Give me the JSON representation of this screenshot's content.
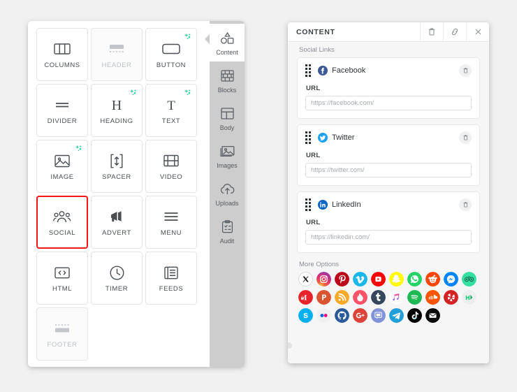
{
  "left_panel": {
    "tiles": [
      {
        "label": "COLUMNS",
        "icon": "columns-icon",
        "disabled": false,
        "sparkle": false,
        "selected": false
      },
      {
        "label": "HEADER",
        "icon": "header-icon",
        "disabled": true,
        "sparkle": false,
        "selected": false
      },
      {
        "label": "BUTTON",
        "icon": "button-icon",
        "disabled": false,
        "sparkle": true,
        "selected": false
      },
      {
        "label": "DIVIDER",
        "icon": "divider-icon",
        "disabled": false,
        "sparkle": false,
        "selected": false
      },
      {
        "label": "HEADING",
        "icon": "heading-icon",
        "disabled": false,
        "sparkle": true,
        "selected": false
      },
      {
        "label": "TEXT",
        "icon": "text-icon",
        "disabled": false,
        "sparkle": true,
        "selected": false
      },
      {
        "label": "IMAGE",
        "icon": "image-icon",
        "disabled": false,
        "sparkle": true,
        "selected": false
      },
      {
        "label": "SPACER",
        "icon": "spacer-icon",
        "disabled": false,
        "sparkle": false,
        "selected": false
      },
      {
        "label": "VIDEO",
        "icon": "video-icon",
        "disabled": false,
        "sparkle": false,
        "selected": false
      },
      {
        "label": "SOCIAL",
        "icon": "social-icon",
        "disabled": false,
        "sparkle": false,
        "selected": true
      },
      {
        "label": "ADVERT",
        "icon": "advert-icon",
        "disabled": false,
        "sparkle": false,
        "selected": false
      },
      {
        "label": "MENU",
        "icon": "menu-icon",
        "disabled": false,
        "sparkle": false,
        "selected": false
      },
      {
        "label": "HTML",
        "icon": "html-icon",
        "disabled": false,
        "sparkle": false,
        "selected": false
      },
      {
        "label": "TIMER",
        "icon": "timer-icon",
        "disabled": false,
        "sparkle": false,
        "selected": false
      },
      {
        "label": "FEEDS",
        "icon": "feeds-icon",
        "disabled": false,
        "sparkle": false,
        "selected": false
      },
      {
        "label": "FOOTER",
        "icon": "footer-icon",
        "disabled": true,
        "sparkle": false,
        "selected": false
      }
    ],
    "selection_color": "#f41616",
    "sparkle_color": "#2fcf95",
    "tabs": [
      {
        "label": "Content",
        "icon": "shapes-icon",
        "active": true
      },
      {
        "label": "Blocks",
        "icon": "bricks-icon",
        "active": false
      },
      {
        "label": "Body",
        "icon": "layout-icon",
        "active": false
      },
      {
        "label": "Images",
        "icon": "photo-icon",
        "active": false
      },
      {
        "label": "Uploads",
        "icon": "cloud-upload-icon",
        "active": false
      },
      {
        "label": "Audit",
        "icon": "clipboard-check-icon",
        "active": false
      }
    ]
  },
  "right_panel": {
    "title": "CONTENT",
    "header_buttons": [
      {
        "name": "delete-button",
        "icon": "trash-icon"
      },
      {
        "name": "duplicate-button",
        "icon": "link-copy-icon"
      },
      {
        "name": "close-button",
        "icon": "close-icon"
      }
    ],
    "social_links_label": "Social Links",
    "more_options_label": "More Options",
    "url_field_label": "URL",
    "links": [
      {
        "name": "Facebook",
        "brand_color": "#3b5998",
        "placeholder": "https://facebook.com/",
        "value": ""
      },
      {
        "name": "Twitter",
        "brand_color": "#1da1f2",
        "placeholder": "https://twitter.com/",
        "value": ""
      },
      {
        "name": "LinkedIn",
        "brand_color": "#0a66c2",
        "placeholder": "https://linkedin.com/",
        "value": ""
      }
    ],
    "more_icons": [
      {
        "name": "x-twitter",
        "color": "#ffffff"
      },
      {
        "name": "instagram",
        "color": "#e1306c"
      },
      {
        "name": "pinterest",
        "color": "#bd081c"
      },
      {
        "name": "vimeo",
        "color": "#1ab7ea"
      },
      {
        "name": "youtube",
        "color": "#ff0000"
      },
      {
        "name": "snapchat",
        "color": "#fffc00"
      },
      {
        "name": "whatsapp",
        "color": "#25d366"
      },
      {
        "name": "reddit",
        "color": "#ff4500"
      },
      {
        "name": "messenger",
        "color": "#0084ff"
      },
      {
        "name": "tripadvisor",
        "color": "#34e0a1"
      },
      {
        "name": "medium",
        "color": "#e8242a"
      },
      {
        "name": "producthunt",
        "color": "#da552f"
      },
      {
        "name": "rss",
        "color": "#f7a928"
      },
      {
        "name": "tinder",
        "color": "#fe5268"
      },
      {
        "name": "tumblr",
        "color": "#36465d"
      },
      {
        "name": "apple-music",
        "color": "#ffffff"
      },
      {
        "name": "spotify",
        "color": "#1db954"
      },
      {
        "name": "soundcloud",
        "color": "#ff5500"
      },
      {
        "name": "yelp",
        "color": "#d32323"
      },
      {
        "name": "mixcloud",
        "color": "#eeeeee"
      },
      {
        "name": "skype",
        "color": "#00aff0"
      },
      {
        "name": "flickr",
        "color": "#f0f0f0"
      },
      {
        "name": "github",
        "color": "#2b5a9b"
      },
      {
        "name": "google-plus",
        "color": "#db4437"
      },
      {
        "name": "disqus",
        "color": "#7f93d6"
      },
      {
        "name": "telegram",
        "color": "#229ed9"
      },
      {
        "name": "tiktok",
        "color": "#010101"
      },
      {
        "name": "email",
        "color": "#0b0b0b"
      }
    ]
  }
}
